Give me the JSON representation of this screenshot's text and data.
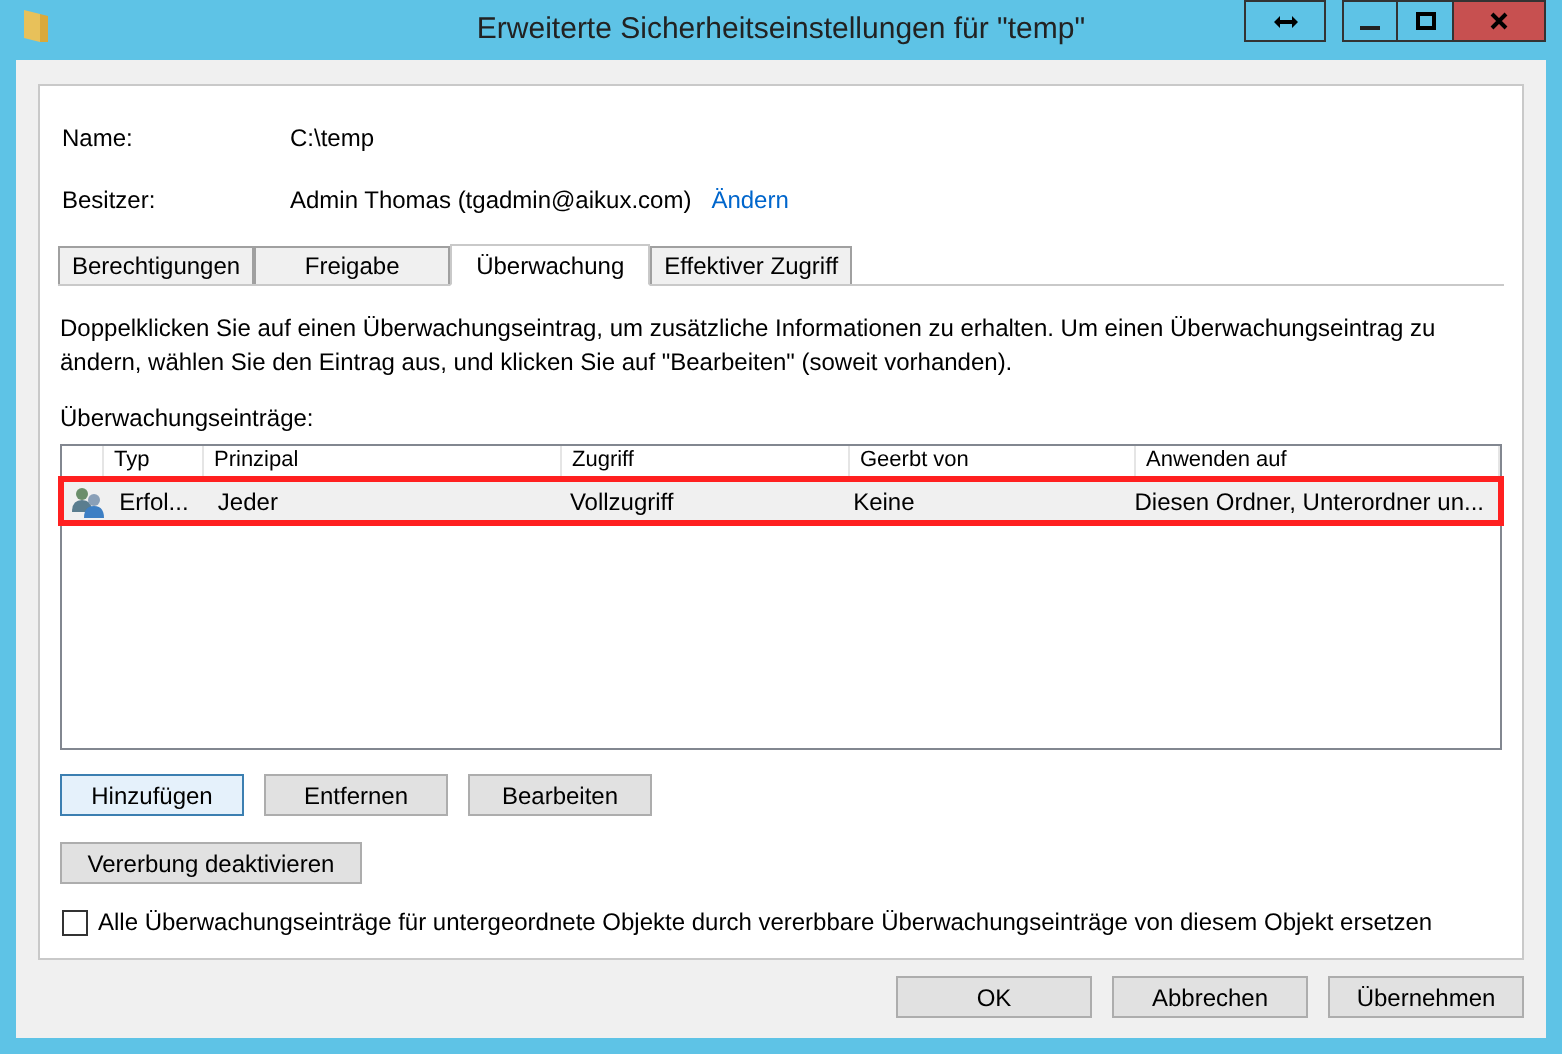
{
  "window": {
    "title": "Erweiterte Sicherheitseinstellungen für \"temp\""
  },
  "fields": [
    {
      "label": "Name:",
      "value": "C:\\temp"
    },
    {
      "label": "Besitzer:",
      "value": "Admin Thomas (tgadmin@aikux.com)",
      "link": "Ändern"
    }
  ],
  "tabs": [
    {
      "label": "Berechtigungen",
      "selected": false
    },
    {
      "label": "Freigabe",
      "selected": false
    },
    {
      "label": "Überwachung",
      "selected": true
    },
    {
      "label": "Effektiver Zugriff",
      "selected": false
    }
  ],
  "description": "Doppelklicken Sie auf einen Überwachungseintrag, um zusätzliche Informationen zu erhalten. Um einen Überwachungseintrag zu ändern, wählen Sie den Eintrag aus, und klicken Sie auf \"Bearbeiten\" (soweit vorhanden).",
  "list_label": "Überwachungseinträge:",
  "table": {
    "columns": [
      "Typ",
      "Prinzipal",
      "Zugriff",
      "Geerbt von",
      "Anwenden auf"
    ],
    "rows": [
      {
        "cells": [
          "Erfol...",
          "Jeder",
          "Vollzugriff",
          "Keine",
          "Diesen Ordner, Unterordner un..."
        ],
        "selected": true,
        "highlighted": true
      }
    ]
  },
  "entry_buttons": [
    {
      "label": "Hinzufügen",
      "focused": true
    },
    {
      "label": "Entfernen",
      "focused": false
    },
    {
      "label": "Bearbeiten",
      "focused": false
    }
  ],
  "inheritance_button": "Vererbung deaktivieren",
  "replace_checkbox": {
    "label": "Alle Überwachungseinträge für untergeordnete Objekte durch vererbbare Überwachungseinträge von diesem Objekt ersetzen",
    "checked": false
  },
  "dialog_buttons": [
    "OK",
    "Abbrechen",
    "Übernehmen"
  ]
}
